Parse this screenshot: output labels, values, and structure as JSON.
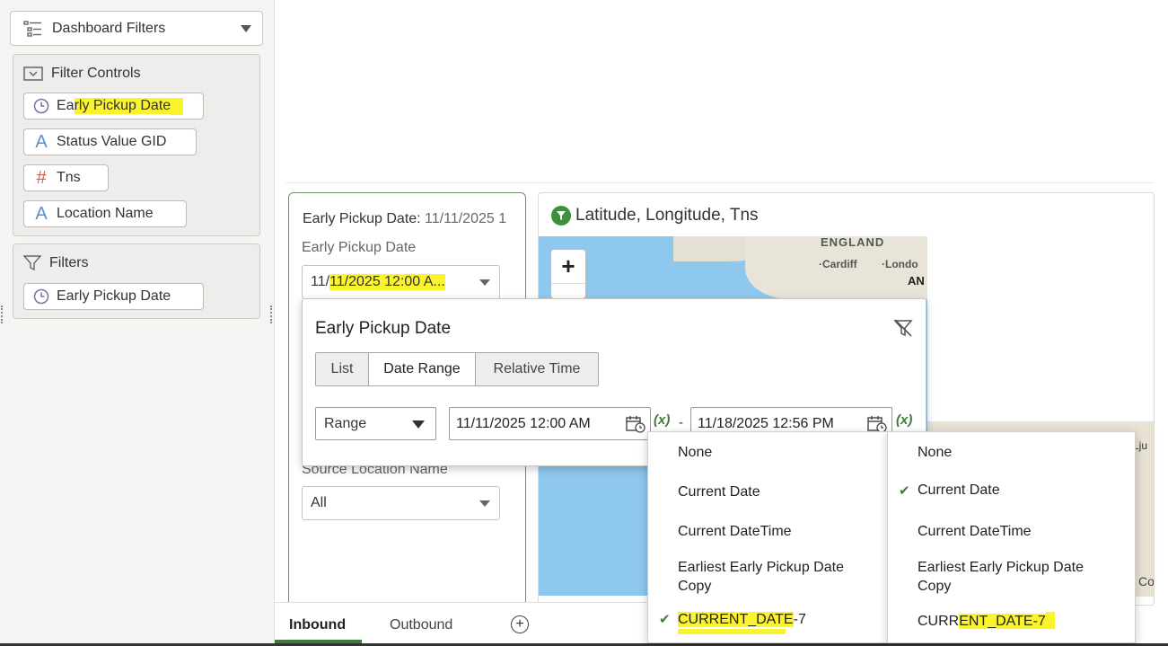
{
  "sidebar": {
    "dashboard_filters_label": "Dashboard Filters",
    "filter_controls": {
      "title": "Filter Controls",
      "items": [
        {
          "label_pre": "Ea",
          "label_hl": "rly Pickup Date",
          "icon": "clock-icon"
        },
        {
          "label": "Status Value GID",
          "icon": "text-attribute-icon"
        },
        {
          "label": "Tns",
          "icon": "hash-icon"
        },
        {
          "label": "Location Name",
          "icon": "text-attribute-icon"
        }
      ]
    },
    "filters": {
      "title": "Filters",
      "items": [
        {
          "label": "Early Pickup Date",
          "icon": "clock-icon"
        }
      ]
    }
  },
  "filter_card": {
    "title_label": "Early Pickup Date:",
    "title_value": " 11/11/2025 1",
    "field_label": "Early Pickup Date",
    "select_pre": "11/",
    "select_hl": "11/2025 12:00 A...",
    "source_label": "Source Location Name",
    "source_value": "All"
  },
  "map": {
    "title": "Latitude, Longitude, Tns",
    "labels": {
      "england": "ENGLAND",
      "cardiff": "·Cardiff",
      "london": "·Londo",
      "an": "AN",
      "lju": "Lju",
      "co": "Co"
    }
  },
  "bottom_tabs": {
    "inbound": "Inbound",
    "outbound": "Outbound",
    "add": "+"
  },
  "popup": {
    "title": "Early Pickup Date",
    "tabs": [
      "List",
      "Date Range",
      "Relative Time"
    ],
    "active_tab": "Date Range",
    "range_value": "Range",
    "start_date": "11/11/2025 12:00 AM",
    "end_date": "11/18/2025 12:56 PM",
    "fx_label": "(x)",
    "dash": "-"
  },
  "left_menu": {
    "items": [
      "None",
      "Current Date",
      "Current DateTime",
      "Earliest Early Pickup Date Copy"
    ],
    "last_hl": "CURRENT_DATE",
    "last_rest": "-7",
    "selected": "CURRENT_DATE-7"
  },
  "right_menu": {
    "items": [
      "None",
      "Current Date",
      "Current DateTime",
      "Earliest Early Pickup Date Copy"
    ],
    "last_pre": "CURR",
    "last_hl": "ENT_DATE-7",
    "selected": "Current Date"
  },
  "colors": {
    "accent_green": "#3f7a3a",
    "highlight": "#fbf32c",
    "map_water": "#8fc8ef"
  }
}
